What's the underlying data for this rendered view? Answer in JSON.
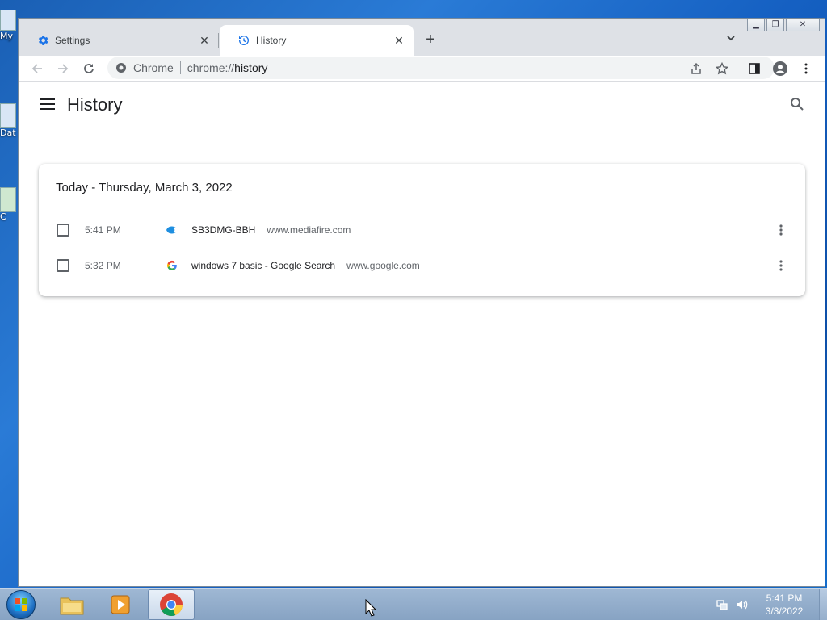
{
  "desktop": {
    "icons": [
      {
        "label": "My"
      },
      {
        "label": "Dat"
      },
      {
        "label": "C"
      }
    ]
  },
  "browser": {
    "tabs": [
      {
        "title": "Settings",
        "icon": "gear-icon",
        "active": false
      },
      {
        "title": "History",
        "icon": "history-icon",
        "active": true
      }
    ],
    "new_tab_label": "+",
    "omnibox": {
      "chip": "Chrome",
      "url_scheme": "chrome://",
      "url_path": "history"
    }
  },
  "history": {
    "title": "History",
    "date_header": "Today - Thursday, March 3, 2022",
    "entries": [
      {
        "time": "5:41 PM",
        "title": "SB3DMG-BBH",
        "domain": "www.mediafire.com",
        "favicon": "mediafire-icon"
      },
      {
        "time": "5:32 PM",
        "title": "windows 7 basic - Google Search",
        "domain": "www.google.com",
        "favicon": "google-icon"
      }
    ]
  },
  "taskbar": {
    "apps": [
      {
        "name": "explorer-taskbar-button",
        "icon": "folder-icon",
        "active": false
      },
      {
        "name": "media-player-taskbar-button",
        "icon": "media-player-icon",
        "active": false
      },
      {
        "name": "chrome-taskbar-button",
        "icon": "chrome-icon",
        "active": true
      }
    ],
    "clock": {
      "time": "5:41 PM",
      "date": "3/3/2022"
    }
  },
  "colors": {
    "accent_blue": "#1a73e8",
    "tab_strip": "#dee1e6",
    "text_primary": "#202124",
    "text_secondary": "#5f6368"
  }
}
